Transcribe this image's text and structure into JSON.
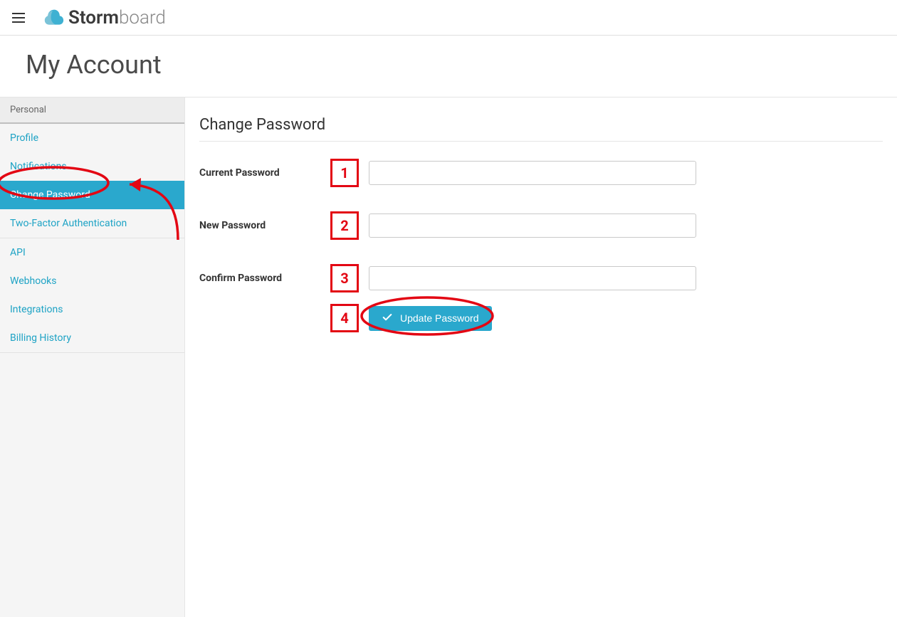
{
  "header": {
    "logo_storm": "Storm",
    "logo_board": "board"
  },
  "page_title": "My Account",
  "sidebar": {
    "section_label": "Personal",
    "items": [
      {
        "label": "Profile",
        "active": false
      },
      {
        "label": "Notifications",
        "active": false
      },
      {
        "label": "Change Password",
        "active": true
      },
      {
        "label": "Two-Factor Authentication",
        "active": false
      }
    ],
    "items2": [
      {
        "label": "API"
      },
      {
        "label": "Webhooks"
      },
      {
        "label": "Integrations"
      },
      {
        "label": "Billing History"
      }
    ]
  },
  "content": {
    "heading": "Change Password",
    "labels": {
      "current": "Current Password",
      "new": "New Password",
      "confirm": "Confirm Password"
    },
    "button_label": "Update Password"
  },
  "annotations": {
    "numbers": {
      "n1": "1",
      "n2": "2",
      "n3": "3",
      "n4": "4"
    }
  },
  "colors": {
    "accent": "#2aa8cd",
    "annotation_red": "#e30613"
  }
}
